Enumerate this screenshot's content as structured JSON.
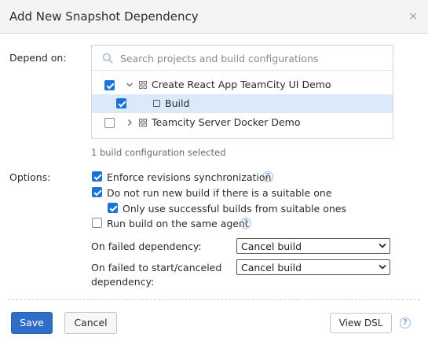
{
  "dialog": {
    "title": "Add New Snapshot Dependency",
    "close_glyph": "×"
  },
  "depend_on": {
    "label": "Depend on:",
    "search": {
      "placeholder": "Search projects and build configurations",
      "value": ""
    },
    "tree": [
      {
        "label": "Create React App TeamCity UI Demo",
        "kind": "project",
        "checked": true,
        "expanded": true
      },
      {
        "label": "Build",
        "kind": "build-configuration",
        "checked": true,
        "selected": true
      },
      {
        "label": "Teamcity Server Docker Demo",
        "kind": "project",
        "checked": false,
        "expanded": false
      }
    ],
    "selection_summary": "1 build configuration selected"
  },
  "options": {
    "label": "Options:",
    "enforce_revisions": {
      "label": "Enforce revisions synchronization",
      "checked": true
    },
    "no_new_build": {
      "label": "Do not run new build if there is a suitable one",
      "checked": true
    },
    "only_successful": {
      "label": "Only use successful builds from suitable ones",
      "checked": true
    },
    "same_agent": {
      "label": "Run build on the same agent",
      "checked": false
    },
    "on_failed": {
      "label": "On failed dependency:",
      "value": "Cancel build"
    },
    "on_failed_start_line1": "On failed to start/canceled",
    "on_failed_start_line2": "dependency:",
    "on_failed_start": {
      "value": "Cancel build"
    },
    "help_glyph": "?"
  },
  "footer": {
    "save_label": "Save",
    "cancel_label": "Cancel",
    "view_dsl_label": "View DSL",
    "help_glyph": "?"
  },
  "colors": {
    "accent": "#2f6ec6",
    "checkbox": "#1d72d8",
    "selected_row": "#dbeafb"
  }
}
